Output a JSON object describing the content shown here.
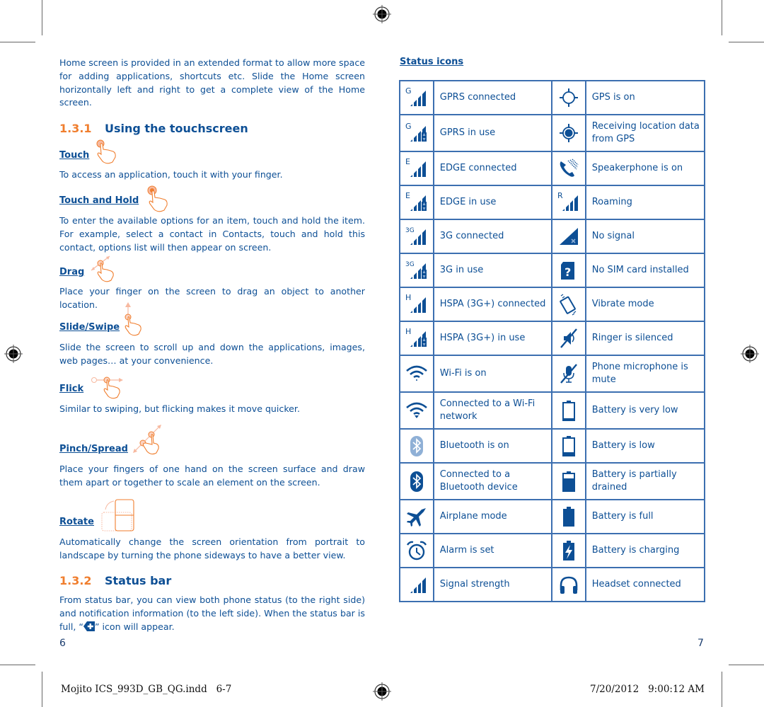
{
  "left_page": {
    "intro": "Home screen is provided in an extended format to allow more space for adding applications, shortcuts etc. Slide the Home screen horizontally left and right to get a complete view of the Home screen.",
    "section_1": {
      "number": "1.3.1",
      "title": "Using the touchscreen"
    },
    "gestures": [
      {
        "label": "Touch",
        "icon": "touch-gesture-icon",
        "description": "To access an application, touch it with your finger."
      },
      {
        "label": "Touch and Hold",
        "icon": "touch-hold-gesture-icon",
        "description": "To enter the available options for an item, touch and hold the item. For example, select a contact in Contacts, touch and hold this contact, options list will then appear on screen."
      },
      {
        "label": "Drag",
        "icon": "drag-gesture-icon",
        "description": "Place your finger on the screen to drag an object to another location."
      },
      {
        "label": "Slide/Swipe",
        "icon": "swipe-gesture-icon",
        "description": "Slide the screen to scroll up and down the applications, images, web pages… at your convenience."
      },
      {
        "label": "Flick",
        "icon": "flick-gesture-icon",
        "description": "Similar to swiping, but flicking makes it move quicker."
      },
      {
        "label": "Pinch/Spread",
        "icon": "pinch-spread-gesture-icon",
        "description": "Place your fingers of one hand on the screen surface and draw them apart or together to scale an element on the screen."
      },
      {
        "label": "Rotate",
        "icon": "rotate-gesture-icon",
        "description": "Automatically change the screen orientation from portrait to landscape by turning the phone sideways to have a better view."
      }
    ],
    "section_2": {
      "number": "1.3.2",
      "title": "Status bar"
    },
    "status_bar_text_1": "From status bar, you can view both phone status (to the right side) and notification information (to the left side). When the status bar is full, “",
    "status_bar_text_2": "”  icon will appear.",
    "page_number": "6"
  },
  "right_page": {
    "title": "Status icons",
    "rows": [
      {
        "left": {
          "icon": "gprs-connected-icon",
          "label": "GPRS connected"
        },
        "right": {
          "icon": "gps-on-icon",
          "label": "GPS is on"
        }
      },
      {
        "left": {
          "icon": "gprs-in-use-icon",
          "label": "GPRS in use"
        },
        "right": {
          "icon": "gps-receiving-icon",
          "label": "Receiving location data from GPS"
        }
      },
      {
        "left": {
          "icon": "edge-connected-icon",
          "label": "EDGE connected"
        },
        "right": {
          "icon": "speakerphone-icon",
          "label": "Speakerphone is on"
        }
      },
      {
        "left": {
          "icon": "edge-in-use-icon",
          "label": "EDGE in use"
        },
        "right": {
          "icon": "roaming-icon",
          "label": "Roaming"
        }
      },
      {
        "left": {
          "icon": "3g-connected-icon",
          "label": "3G connected"
        },
        "right": {
          "icon": "no-signal-icon",
          "label": "No signal"
        }
      },
      {
        "left": {
          "icon": "3g-in-use-icon",
          "label": "3G in use"
        },
        "right": {
          "icon": "no-sim-icon",
          "label": "No SIM card installed"
        }
      },
      {
        "left": {
          "icon": "hspa-connected-icon",
          "label": "HSPA (3G+) connected"
        },
        "right": {
          "icon": "vibrate-icon",
          "label": "Vibrate mode"
        }
      },
      {
        "left": {
          "icon": "hspa-in-use-icon",
          "label": "HSPA (3G+) in use"
        },
        "right": {
          "icon": "ringer-silenced-icon",
          "label": "Ringer is silenced"
        }
      },
      {
        "left": {
          "icon": "wifi-on-icon",
          "label": "Wi-Fi is on"
        },
        "right": {
          "icon": "mic-mute-icon",
          "label": "Phone microphone is mute"
        }
      },
      {
        "left": {
          "icon": "wifi-connected-icon",
          "label": "Connected to a Wi-Fi network"
        },
        "right": {
          "icon": "battery-very-low-icon",
          "label": "Battery is very low"
        }
      },
      {
        "left": {
          "icon": "bluetooth-on-icon",
          "label": "Bluetooth is on"
        },
        "right": {
          "icon": "battery-low-icon",
          "label": "Battery is low"
        }
      },
      {
        "left": {
          "icon": "bluetooth-connected-icon",
          "label": "Connected to a Bluetooth device"
        },
        "right": {
          "icon": "battery-partial-icon",
          "label": "Battery is partially drained"
        }
      },
      {
        "left": {
          "icon": "airplane-mode-icon",
          "label": "Airplane mode"
        },
        "right": {
          "icon": "battery-full-icon",
          "label": "Battery is full"
        }
      },
      {
        "left": {
          "icon": "alarm-icon",
          "label": "Alarm is set"
        },
        "right": {
          "icon": "battery-charging-icon",
          "label": "Battery is charging"
        }
      },
      {
        "left": {
          "icon": "signal-strength-icon",
          "label": "Signal strength"
        },
        "right": {
          "icon": "headset-icon",
          "label": "Headset connected"
        }
      }
    ],
    "page_number": "7"
  },
  "footer": {
    "filename": "Mojito ICS_993D_GB_QG.indd   6-7",
    "timestamp": "7/20/2012   9:00:12 AM"
  },
  "colors": {
    "text": "#0d4f95",
    "accent": "#f07e2e",
    "table_border": "#3c6fb0"
  }
}
